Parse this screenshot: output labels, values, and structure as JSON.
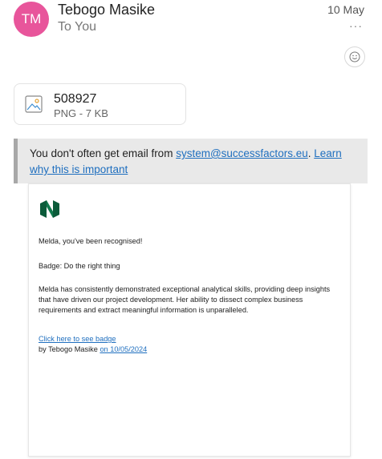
{
  "header": {
    "avatar_initials": "TM",
    "sender_name": "Tebogo Masike",
    "recipient": "To You",
    "date": "10 May",
    "more_icon": "ellipsis-icon",
    "reaction_icon": "smiley-icon",
    "avatar_color": "#e8559b"
  },
  "attachment": {
    "icon": "image-file-icon",
    "name": "508927",
    "meta": "PNG - 7 KB"
  },
  "warning": {
    "text_before": "You don't often get email from ",
    "sender_email": "system@successfactors.eu",
    "text_after": ". ",
    "link_label": "Learn why this is important"
  },
  "email": {
    "logo_icon": "nedbank-logo-icon",
    "greeting": "Melda, you've been recognised!",
    "badge": "Badge: Do the right thing",
    "message": "Melda has consistently demonstrated exceptional analytical skills, providing deep insights that have driven our project development. Her ability to dissect complex business requirements and extract meaningful information is unparalleled.",
    "badge_link": "Click here to see badge",
    "by_text": "by Tebogo Masike ",
    "date_link": "on 10/05/2024",
    "brand_color": "#0b5b3a",
    "link_color": "#1f6fbf"
  }
}
